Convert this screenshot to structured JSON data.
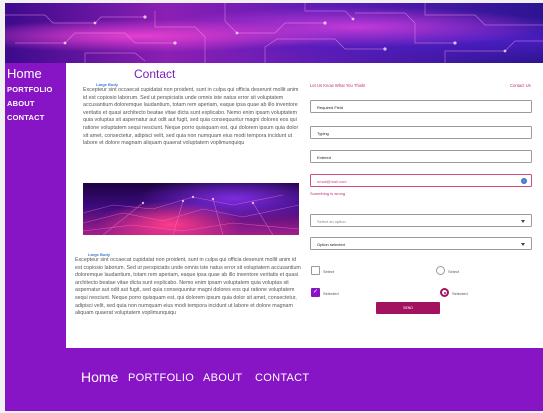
{
  "nav": {
    "home": "Home",
    "items": [
      "PORTFOLIO",
      "ABOUT",
      "CONTACT"
    ]
  },
  "page": {
    "title": "Contact",
    "caption_1": "Large Body",
    "caption_2": "Large Body",
    "paragraph_1": "Excepteur sint occaecat cupidatat non proident, sunt in culpa qui officia deserunt mollit anim id est copiosio laborum. Sed ut perspiciatis unde omnis iste natus error sit voluptatem accusantium doloremque laudantium, totam rem aperiam, eaque ipsa quae ab illo inventore veritatis et quasi architecto beatae vitae dicta sunt explicabo. Nemo enim ipsam voluptatem quia voluptas sit aspernatur aut odit aut fugit, sed quia consequuntur magni dolores eos qui ratione voluptatem sequi nesciunt. Neque porro quisquam est, qui dolorem ipsum quia dolor sit amet, consectetur, adipisci velit, sed quia non numquam eius modi tempora incidunt ut labore et dolore magnam aliquam quaerat voluptatem voplimunquiqu",
    "paragraph_2": "Excepteur sint occaecat cupidatat non proident, sunt in culpa qui officia deserunt mollit anim id est copiosio laborum. Sed ut perspiciatis unde omnis iste natus error sit voluptatem accusantium doloremque laudantium, totam rem aperiam, eaque ipsa quae ab illo inventore veritatis et quasi architecto beatae vitae dicta sunt explicabo. Nemo enim ipsam voluptatem quia voluptas sit aspernatur aut odit aut fugit, sed quia consequuntur magni dolores eos qui ratione voluptatem sequi nesciunt. Neque porro quisquam est, qui dolorem ipsum quia dolor sit amet, consectetur, adipisci velit, sed quia non numquam eius modi tempora incidunt ut labore et dolore magnam aliquam quaerat voluptatem voplimunquiqu"
  },
  "form": {
    "heading": "Let Us Know What You Think!",
    "contact_link": "Contact Us",
    "field_required": "Required Field",
    "field_typing": "Typing",
    "field_entered": "Entered",
    "field_error_value": "email@mail.com",
    "error_message": "Something is wrong",
    "select_placeholder": "Select an option",
    "select_value": "Option selected",
    "checkbox_unchecked": "Select",
    "radio_unchecked": "Select",
    "checkbox_checked": "Selected",
    "radio_checked": "Selected",
    "submit_label": "SEND",
    "info_icon": "i"
  },
  "footer": {
    "home": "Home",
    "items": [
      "PORTFOLIO",
      "ABOUT",
      "CONTACT"
    ]
  },
  "colors": {
    "nav_purple": "#8714c5",
    "accent_magenta": "#a3125f",
    "title_purple": "#7a1fb8"
  }
}
